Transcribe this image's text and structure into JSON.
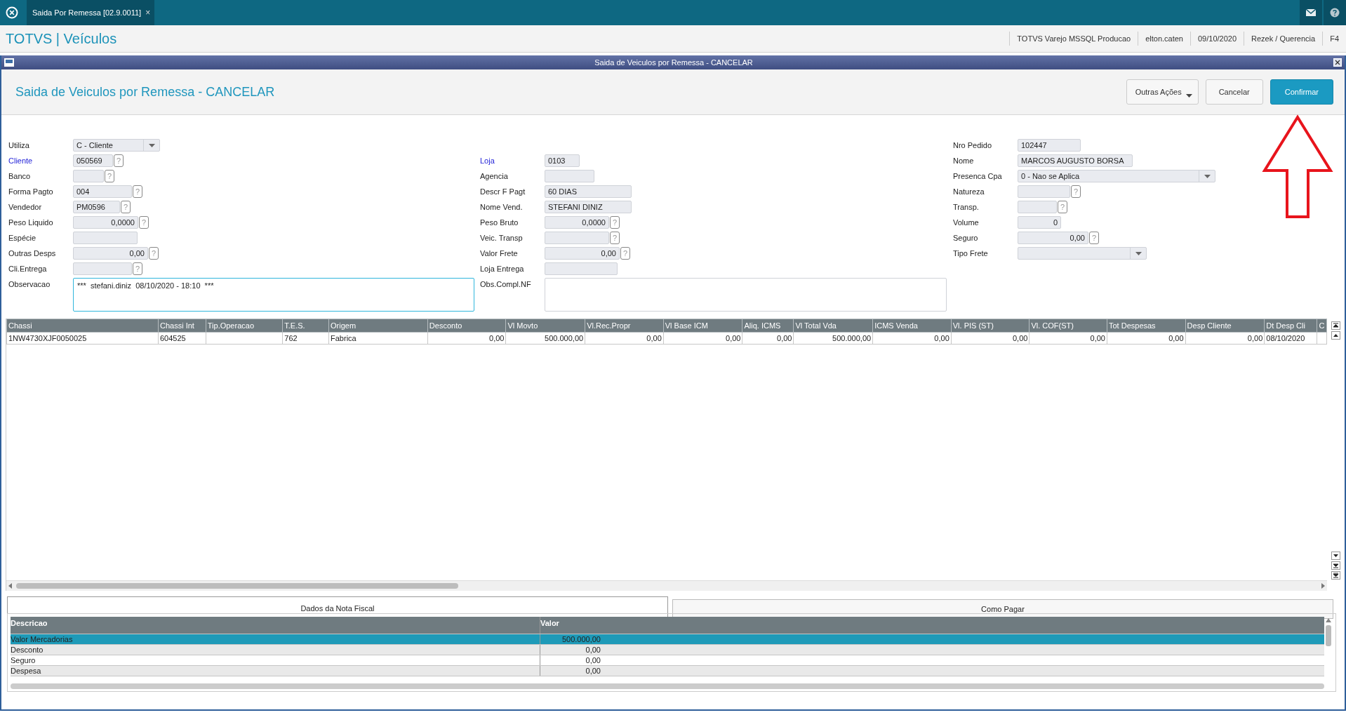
{
  "top_bar": {
    "tab": {
      "label": "Saida Por Remessa [02.9.0011]",
      "close": "×"
    }
  },
  "header": {
    "brand": "TOTVS | Veículos",
    "info": [
      "TOTVS Varejo MSSQL Producao",
      "elton.caten",
      "09/10/2020",
      "Rezek / Querencia",
      "F4"
    ]
  },
  "window": {
    "title": "Saida de Veiculos por Remessa - CANCELAR",
    "heading": "Saida de Veiculos por Remessa - CANCELAR",
    "buttons": [
      {
        "label": "Outras Ações",
        "kind": "menu"
      },
      {
        "label": "Cancelar",
        "kind": "default"
      },
      {
        "label": "Confirmar",
        "kind": "primary"
      }
    ]
  },
  "form": {
    "columns": [
      [
        {
          "label": "Utiliza",
          "value": "C - Cliente",
          "kind": "select",
          "required": false
        },
        {
          "label": "Cliente",
          "value": "050569",
          "kind": "text",
          "required": true,
          "help": "?"
        },
        {
          "label": "Banco",
          "kind": "text",
          "required": false,
          "help": "?"
        },
        {
          "label": "Forma Pagto",
          "value": "004",
          "kind": "text",
          "required": false,
          "help": "?"
        },
        {
          "label": "Vendedor",
          "value": "PM0596",
          "kind": "text",
          "required": false,
          "help": "?"
        },
        {
          "label": "Peso Liquido",
          "value": "0,0000",
          "kind": "number",
          "required": false,
          "help": "?"
        },
        {
          "label": "Espécie",
          "kind": "text",
          "required": false
        },
        {
          "label": "Outras Desps",
          "value": "0,00",
          "kind": "number",
          "required": false,
          "help": "?"
        },
        {
          "label": "Cli.Entrega",
          "kind": "text",
          "required": false,
          "help": "?"
        },
        {
          "label": "Observacao",
          "value": "***  stefani.diniz  08/10/2020 - 18:10  ***",
          "kind": "memo",
          "required": false
        }
      ],
      [
        {
          "label": "Loja",
          "value": "0103",
          "kind": "text",
          "required": true
        },
        {
          "label": "Agencia",
          "kind": "text",
          "required": false
        },
        {
          "label": "Descr F Pagt",
          "value": "60 DIAS",
          "kind": "text",
          "required": false
        },
        {
          "label": "Nome Vend.",
          "value": "STEFANI DINIZ",
          "kind": "text",
          "required": false
        },
        {
          "label": "Peso Bruto",
          "value": "0,0000",
          "kind": "number",
          "required": false,
          "help": "?"
        },
        {
          "label": "Veic. Transp",
          "kind": "text",
          "required": false,
          "help": "?"
        },
        {
          "label": "Valor Frete",
          "value": "0,00",
          "kind": "number",
          "required": false,
          "help": "?"
        },
        {
          "label": "Loja Entrega",
          "kind": "text",
          "required": false
        },
        {
          "label": "Obs.Compl.NF",
          "kind": "memo",
          "required": false
        }
      ],
      [
        {
          "label": "Nro Pedido",
          "value": "102447",
          "kind": "text",
          "required": false
        },
        {
          "label": "Nome",
          "value": "MARCOS AUGUSTO BORSA",
          "kind": "text",
          "required": false
        },
        {
          "label": "Presenca Cpa",
          "value": "0 - Nao se Aplica",
          "kind": "select",
          "required": false
        },
        {
          "label": "Natureza",
          "kind": "text",
          "required": false,
          "help": "?"
        },
        {
          "label": "Transp.",
          "kind": "text",
          "required": false,
          "help": "?"
        },
        {
          "label": "Volume",
          "value": "0",
          "kind": "number",
          "required": false
        },
        {
          "label": "Seguro",
          "value": "0,00",
          "kind": "number",
          "required": false,
          "help": "?"
        },
        {
          "label": "Tipo Frete",
          "kind": "select",
          "required": false
        }
      ]
    ]
  },
  "grid": {
    "columns": [
      {
        "label": "Chassi",
        "kind": "text"
      },
      {
        "label": "Chassi Int",
        "kind": "text"
      },
      {
        "label": "Tip.Operacao",
        "kind": "text"
      },
      {
        "label": "T.E.S.",
        "kind": "text"
      },
      {
        "label": "Origem",
        "kind": "text"
      },
      {
        "label": "Desconto",
        "kind": "number"
      },
      {
        "label": "Vl Movto",
        "kind": "number"
      },
      {
        "label": "Vl.Rec.Propr",
        "kind": "number"
      },
      {
        "label": "Vl Base ICM",
        "kind": "number"
      },
      {
        "label": "Aliq. ICMS",
        "kind": "number"
      },
      {
        "label": "Vl Total Vda",
        "kind": "number"
      },
      {
        "label": "ICMS Venda",
        "kind": "number"
      },
      {
        "label": "Vl. PIS (ST)",
        "kind": "number"
      },
      {
        "label": "Vl. COF(ST)",
        "kind": "number"
      },
      {
        "label": "Tot Despesas",
        "kind": "number"
      },
      {
        "label": "Desp Cliente",
        "kind": "number"
      },
      {
        "label": "Dt Desp Cli",
        "kind": "text"
      },
      {
        "label": "C",
        "kind": "text"
      }
    ],
    "rows": [
      [
        "1NW4730XJF0050025",
        "604525",
        "",
        "762",
        "Fabrica",
        "0,00",
        "500.000,00",
        "0,00",
        "0,00",
        "0,00",
        "500.000,00",
        "0,00",
        "0,00",
        "0,00",
        "0,00",
        "0,00",
        "08/10/2020"
      ]
    ]
  },
  "tabs": [
    {
      "label": "Dados da Nota Fiscal",
      "selected": true
    },
    {
      "label": "Como Pagar",
      "selected": false
    }
  ],
  "summary": {
    "columns": [
      "Descricao",
      "Valor"
    ],
    "rows": [
      {
        "cells": [
          "Valor Mercadorias",
          "500.000,00"
        ],
        "selected": true
      },
      {
        "cells": [
          "Desconto",
          "0,00"
        ],
        "selected": false
      },
      {
        "cells": [
          "Seguro",
          "0,00"
        ],
        "selected": false
      },
      {
        "cells": [
          "Despesa",
          "0,00"
        ],
        "selected": false
      }
    ]
  }
}
